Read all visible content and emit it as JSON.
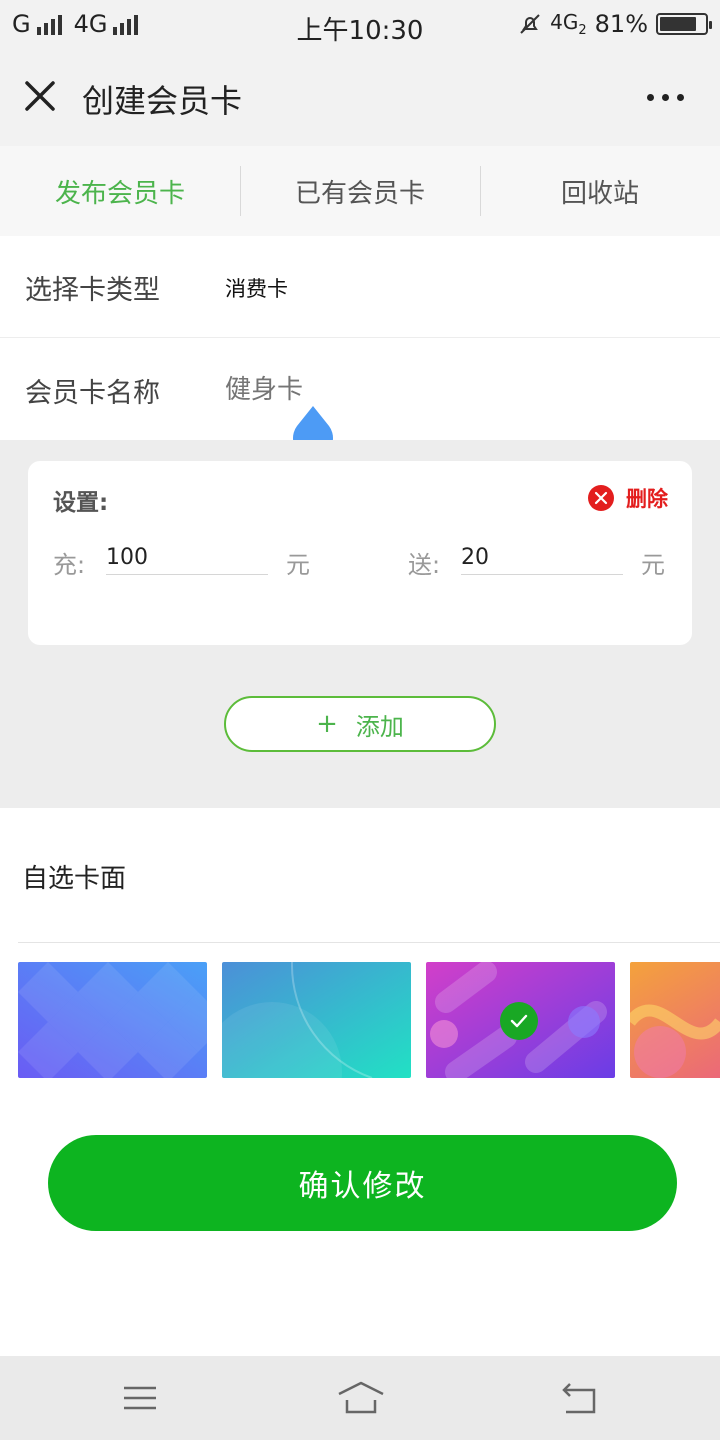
{
  "status_bar": {
    "carrier1": "G",
    "carrier2": "4G",
    "time": "上午10:30",
    "network": "4G",
    "network_sub": "2",
    "battery": "81%",
    "battery_level": 0.81
  },
  "nav": {
    "title": "创建会员卡",
    "close_icon": "close-icon",
    "more_icon": "more-icon"
  },
  "tabs": [
    {
      "label": "发布会员卡",
      "active": true
    },
    {
      "label": "已有会员卡",
      "active": false
    },
    {
      "label": "回收站",
      "active": false
    }
  ],
  "form": {
    "type_label": "选择卡类型",
    "type_value": "消费卡",
    "name_label": "会员卡名称",
    "name_placeholder": "健身卡"
  },
  "settings": {
    "title": "设置:",
    "delete_label": "删除",
    "charge_label": "充:",
    "charge_value": "100",
    "charge_unit": "元",
    "bonus_label": "送:",
    "bonus_value": "20",
    "bonus_unit": "元"
  },
  "add_button": {
    "icon": "+",
    "label": "添加"
  },
  "card_face": {
    "title": "自选卡面",
    "selected_index": 2,
    "faces": [
      "blue-purple-diamond",
      "blue-teal",
      "purple-magenta",
      "orange-pink"
    ]
  },
  "confirm_button": {
    "label": "确认修改"
  },
  "colors": {
    "accent_green": "#4cb44c",
    "confirm_green": "#0db420",
    "delete_red": "#e31e1e"
  }
}
